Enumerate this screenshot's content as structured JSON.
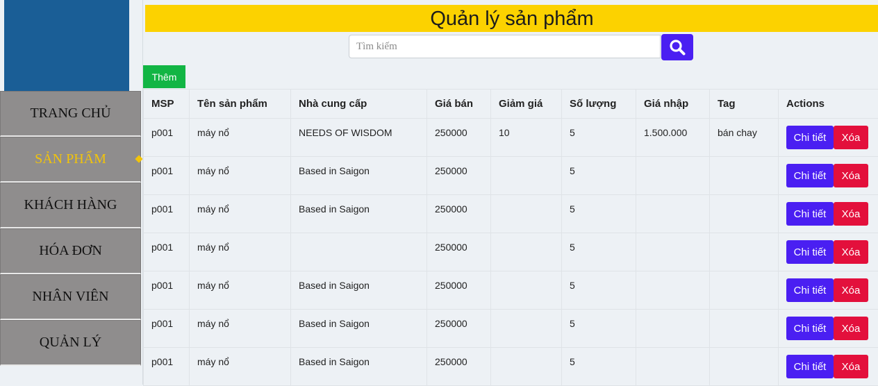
{
  "sidebar": {
    "items": [
      {
        "label": "TRANG CHỦ"
      },
      {
        "label": "SẢN PHẨM"
      },
      {
        "label": "KHÁCH HÀNG"
      },
      {
        "label": "HÓA ĐƠN"
      },
      {
        "label": "NHÂN VIÊN"
      },
      {
        "label": "QUẢN LÝ"
      }
    ],
    "active_index": 1
  },
  "header": {
    "title": "Quản lý sản phẩm"
  },
  "search": {
    "placeholder": "Tìm kiếm",
    "value": ""
  },
  "toolbar": {
    "add_label": "Thêm"
  },
  "table": {
    "columns": [
      "MSP",
      "Tên sản phẩm",
      "Nhà cung cấp",
      "Giá bán",
      "Giảm giá",
      "Số lượng",
      "Giá nhập",
      "Tag",
      "Actions"
    ],
    "rows": [
      [
        "p001",
        "máy nổ",
        "NEEDS OF WISDOM",
        "250000",
        "10",
        "5",
        "1.500.000",
        "bán chay"
      ],
      [
        "p001",
        "máy nổ",
        "Based in Saigon",
        "250000",
        "",
        "5",
        "",
        ""
      ],
      [
        "p001",
        "máy nổ",
        "Based in Saigon",
        "250000",
        "",
        "5",
        "",
        ""
      ],
      [
        "p001",
        "máy nổ",
        "",
        "250000",
        "",
        "5",
        "",
        ""
      ],
      [
        "p001",
        "máy nổ",
        "Based in Saigon",
        "250000",
        "",
        "5",
        "",
        ""
      ],
      [
        "p001",
        "máy nổ",
        "Based in Saigon",
        "250000",
        "",
        "5",
        "",
        ""
      ],
      [
        "p001",
        "máy nổ",
        "Based in Saigon",
        "250000",
        "",
        "5",
        "",
        ""
      ]
    ],
    "detail_label": "Chi tiết",
    "delete_label": "Xóa"
  },
  "colors": {
    "title_bar": "#fcd200",
    "sidebar_bg": "#8f8d8d",
    "active_nav": "#f2c40a",
    "logo_block": "#1a5e96",
    "add_button": "#12b544",
    "detail_button": "#4a1ff2",
    "delete_button": "#e3103c",
    "search_button": "#4a1ff2"
  },
  "icons": {
    "search_button": "search-icon"
  }
}
